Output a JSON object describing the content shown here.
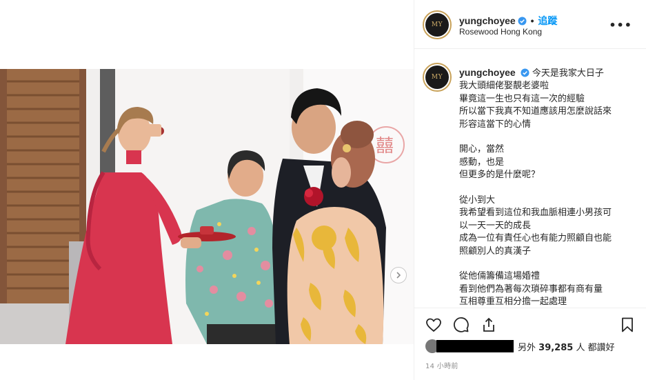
{
  "post": {
    "username": "yungchoyee",
    "follow_label": "追蹤",
    "separator": "•",
    "location": "Rosewood Hong Kong",
    "more_label": "•••",
    "avatar_logo": "MY"
  },
  "caption": {
    "username": "yungchoyee",
    "lines": [
      "今天是我家大日子",
      "我大頭細佬娶靚老婆啦",
      "畢竟這一生也只有這一次的經驗",
      "所以當下我真不知道應該用怎麼說話來",
      "形容這當下的心情",
      "",
      "開心，當然",
      "感動，也是",
      "但更多的是什麼呢？",
      "",
      "從小到大",
      "我希望看到這位和我血脈相連小男孩可",
      "以一天一天的成長",
      "成為一位有責任心也有能力照顧自也能",
      "照顧別人的真漢子",
      "",
      "從他倆籌備這場婚禮",
      "看到他們為著每次瑣碎事都有商有量",
      "互相尊重互相分擔一起處理"
    ]
  },
  "engagement": {
    "likes_prefix": "另外",
    "likes_count": "39,285",
    "likes_suffix": "人 都讚好",
    "timestamp": "14 小時前"
  },
  "icons": {
    "verified": "verified-badge-icon",
    "like": "heart-icon",
    "comment": "comment-icon",
    "share": "share-icon",
    "save": "bookmark-icon",
    "next": "chevron-right-icon"
  },
  "colors": {
    "accent": "#0095f6",
    "verified": "#3897f0",
    "text": "#262626",
    "muted": "#8e8e8e"
  }
}
